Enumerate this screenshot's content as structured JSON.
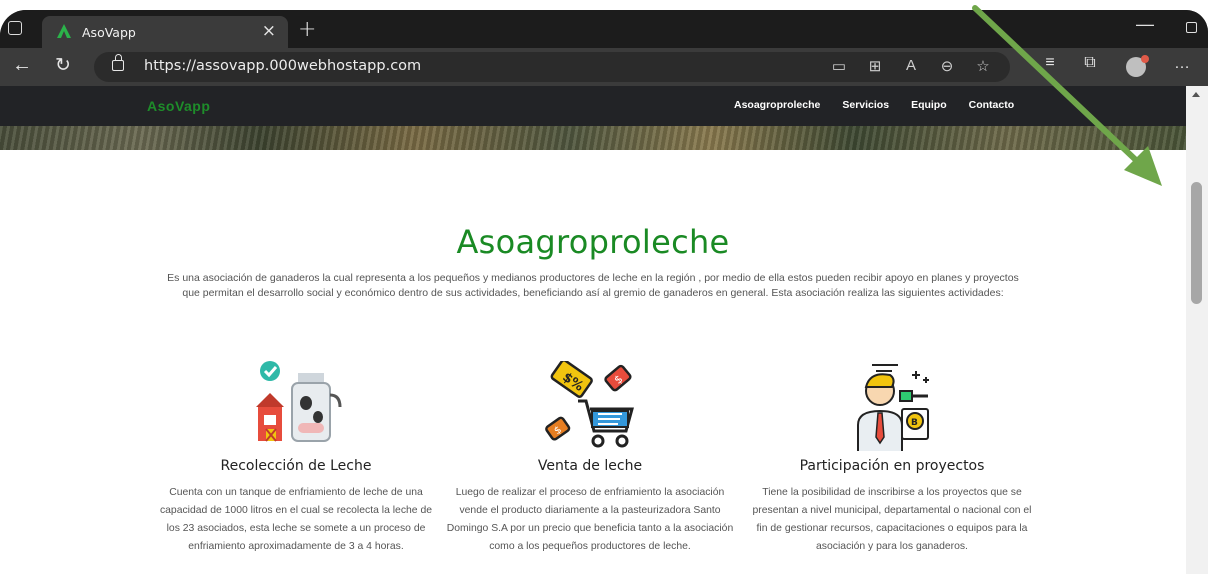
{
  "browser": {
    "tab_title": "AsoVapp",
    "tab_close": "×",
    "new_tab": "+",
    "url": "https://assovapp.000webhostapp.com",
    "icons": [
      "back-icon",
      "reload-icon",
      "lock-icon",
      "screencast-icon",
      "apps-icon",
      "read-aloud-icon",
      "zoom-icon",
      "favorite-add-icon",
      "favorites-icon",
      "collections-icon",
      "profile-icon",
      "more-icon"
    ]
  },
  "site": {
    "brand": "AsoVapp",
    "menu": [
      "Asoagroproleche",
      "Servicios",
      "Equipo",
      "Contacto"
    ]
  },
  "section": {
    "title": "Asoagroproleche",
    "intro": "Es una asociación de ganaderos la cual representa a los pequeños y medianos productores de leche en la región , por medio de ella estos pueden recibir apoyo en planes y proyectos que permitan el desarrollo social y económico dentro de sus actividades, beneficiando así al gremio de ganaderos en general. Esta asociación realiza las siguientes actividades:",
    "features": [
      {
        "title": "Recolección de Leche",
        "text": "Cuenta con un tanque de enfriamiento de leche de una capacidad de 1000 litros en el cual se recolecta la leche de los 23 asociados, esta leche se somete a un proceso de enfriamiento aproximadamente de 3 a 4 horas.",
        "icon": "milk-farm-icon"
      },
      {
        "title": "Venta de leche",
        "text": "Luego de realizar el proceso de enfriamiento la asociación vende el producto diariamente a la pasteurizadora Santo Domingo S.A por un precio que beneficia tanto a la asociación como a los pequeños productores de leche.",
        "icon": "shopping-cart-icon"
      },
      {
        "title": "Participación en proyectos",
        "text": "Tiene la posibilidad de inscribirse a los proyectos que se presentan a nivel municipal, departamental o nacional con el fin de gestionar recursos, capacitaciones o equipos para la asociación y para los ganaderos.",
        "icon": "investor-icon"
      }
    ]
  },
  "colors": {
    "brand_green": "#1e8d2a",
    "nav_bg": "#222326",
    "annotation_arrow": "#6fa64a"
  }
}
